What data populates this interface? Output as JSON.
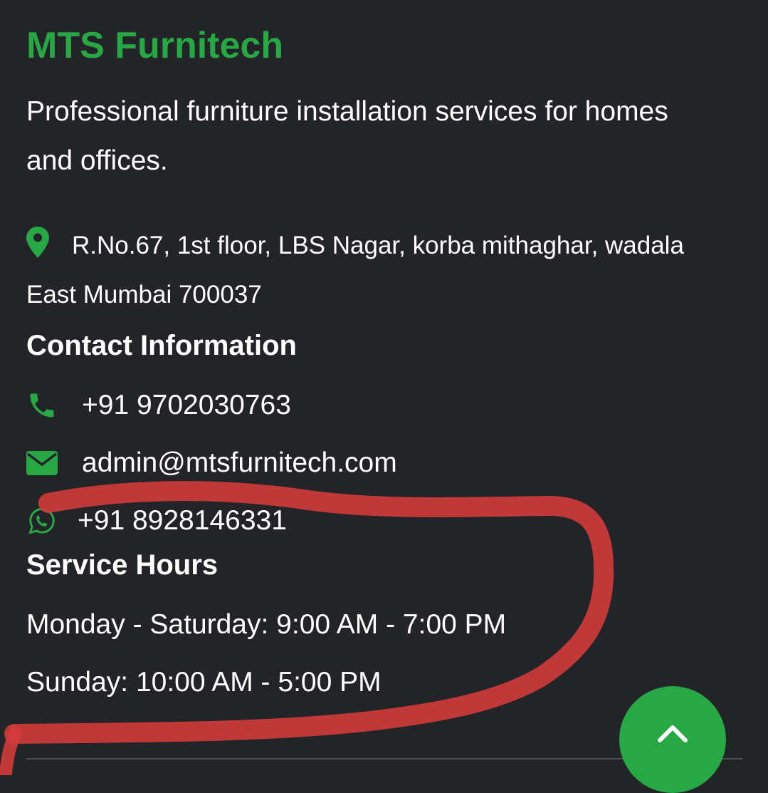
{
  "footer": {
    "brand": "MTS Furnitech",
    "tagline": "Professional furniture installation services for homes and offices.",
    "address_icon": "map-marker-icon",
    "address": "R.No.67, 1st floor, LBS Nagar, korba mithaghar, wadala East Mumbai 700037",
    "contact_heading": "Contact Information",
    "contacts": [
      {
        "icon": "phone-icon",
        "text": "+91 9702030763"
      },
      {
        "icon": "envelope-icon",
        "text": "admin@mtsfurnitech.com"
      },
      {
        "icon": "whatsapp-icon",
        "text": "+91 8928146331"
      }
    ],
    "hours_heading": "Service Hours",
    "hours": [
      "Monday - Saturday: 9:00 AM - 7:00 PM",
      "Sunday: 10:00 AM - 5:00 PM"
    ]
  },
  "scroll_top_icon": "chevron-up-icon",
  "colors": {
    "accent": "#28a745",
    "background": "#222427",
    "annotation": "#d23b3b"
  }
}
